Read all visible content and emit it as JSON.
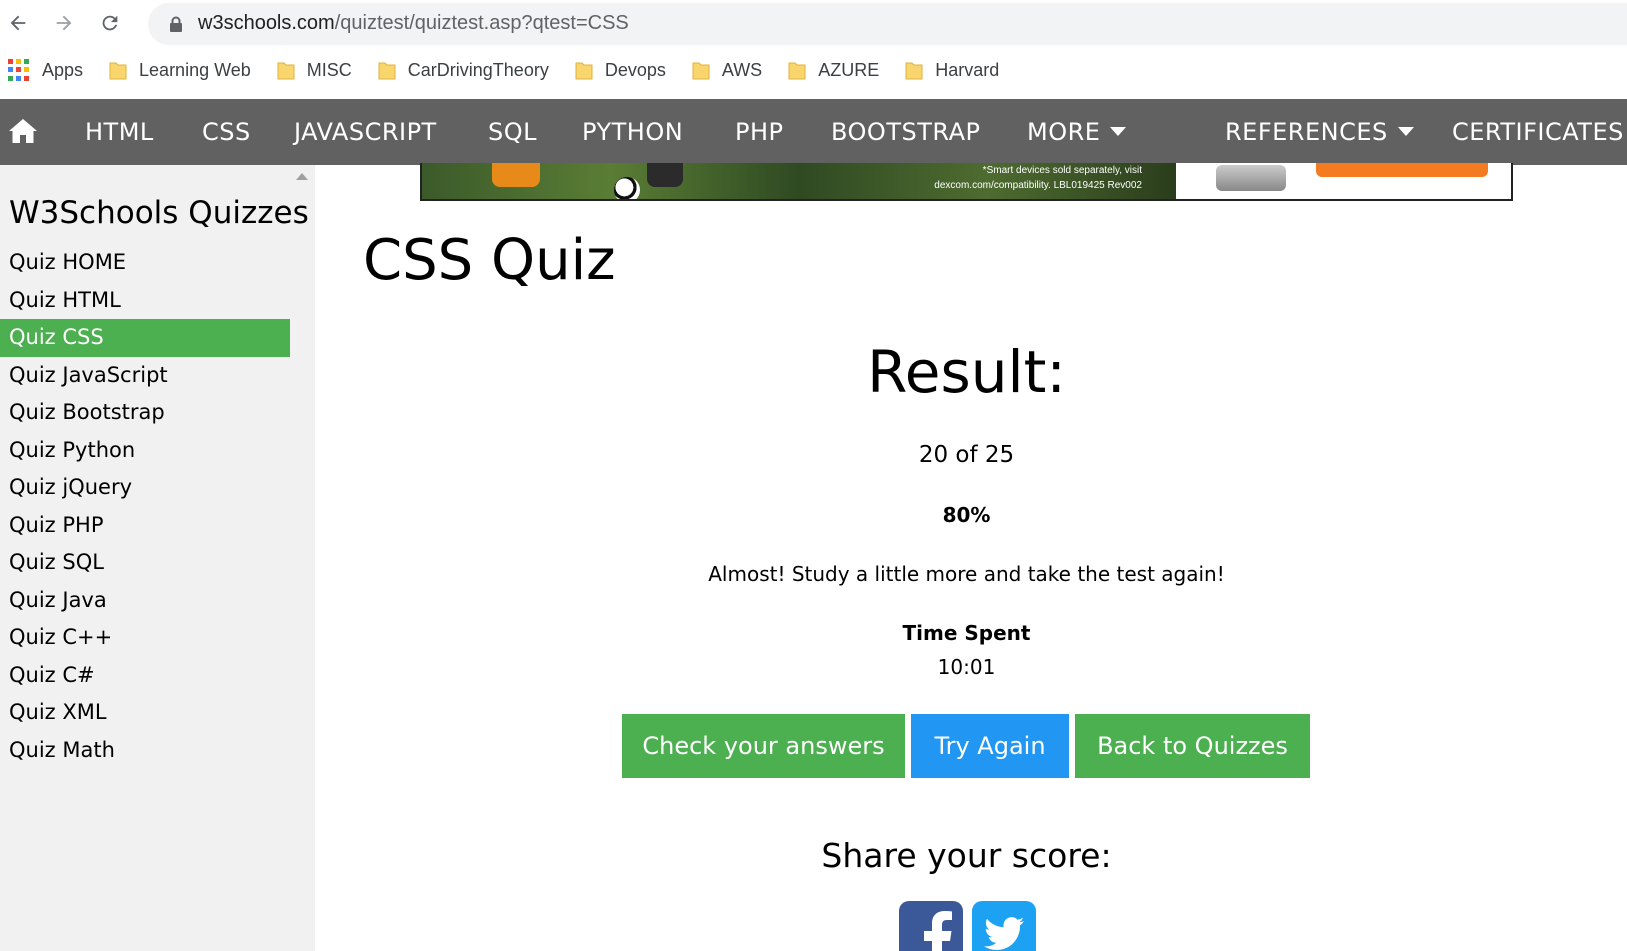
{
  "browser": {
    "url_host": "w3schools.com",
    "url_path": "/quiztest/quiztest.asp?qtest=CSS"
  },
  "bookmarks": [
    {
      "label": "Apps",
      "icon": "apps-grid-icon"
    },
    {
      "label": "Learning Web",
      "icon": "folder-icon"
    },
    {
      "label": "MISC",
      "icon": "folder-icon"
    },
    {
      "label": "CarDrivingTheory",
      "icon": "folder-icon"
    },
    {
      "label": "Devops",
      "icon": "folder-icon"
    },
    {
      "label": "AWS",
      "icon": "folder-icon"
    },
    {
      "label": "AZURE",
      "icon": "folder-icon"
    },
    {
      "label": "Harvard",
      "icon": "folder-icon"
    }
  ],
  "topnav": {
    "items": [
      "HTML",
      "CSS",
      "JAVASCRIPT",
      "SQL",
      "PYTHON",
      "PHP",
      "BOOTSTRAP",
      "MORE",
      "REFERENCES",
      "CERTIFICATES"
    ],
    "background": "#616161"
  },
  "ad": {
    "fine_print_1": "*Smart devices sold separately, visit",
    "fine_print_2": "dexcom.com/compatibility. LBL019425 Rev002"
  },
  "sidebar": {
    "title": "W3Schools Quizzes",
    "items": [
      "Quiz HOME",
      "Quiz HTML",
      "Quiz CSS",
      "Quiz JavaScript",
      "Quiz Bootstrap",
      "Quiz Python",
      "Quiz jQuery",
      "Quiz PHP",
      "Quiz SQL",
      "Quiz Java",
      "Quiz C++",
      "Quiz C#",
      "Quiz XML",
      "Quiz Math"
    ],
    "active_item": "Quiz CSS",
    "active_color": "#4caf50"
  },
  "main": {
    "title": "CSS Quiz",
    "result_title": "Result:",
    "score": "20 of 25",
    "percent": "80%",
    "message": "Almost! Study a little more and take the test again!",
    "time_label": "Time Spent",
    "time_value": "10:01",
    "buttons": {
      "check": "Check your answers",
      "try_again": "Try Again",
      "back": "Back to Quizzes"
    },
    "share_title": "Share your score:",
    "accent_green": "#4caf50",
    "accent_blue": "#2196f3"
  }
}
